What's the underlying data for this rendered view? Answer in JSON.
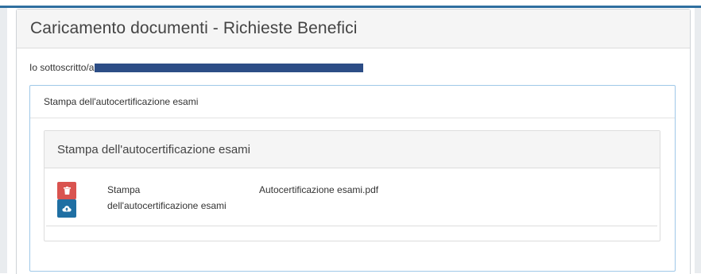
{
  "page": {
    "title": "Caricamento documenti - Richieste Benefici",
    "signer_prefix": "Io sottoscritto/a"
  },
  "section": {
    "header": "Stampa dell'autocertificazione esami",
    "card_title": "Stampa dell'autocertificazione esami"
  },
  "documents": [
    {
      "name": "Stampa dell'autocertificazione esami",
      "file_name": "Autocertificazione esami.pdf",
      "delete_icon": "trash-icon",
      "upload_icon": "cloud-upload-icon"
    }
  ],
  "colors": {
    "accent_blue": "#1f6fa3",
    "danger_red": "#d9534f",
    "redaction": "#2c4d86",
    "top_border": "#2f6f9f"
  }
}
